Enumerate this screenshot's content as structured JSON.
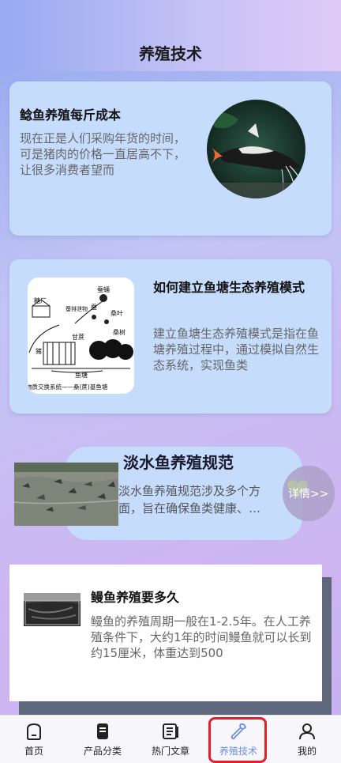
{
  "header": {
    "title": "养殖技术"
  },
  "articles": [
    {
      "title": "鲶鱼养殖每斤成本",
      "desc": "现在正是人们采购年货的时间，可是猪肉的价格一直居高不下，让很多消费者望而",
      "image": "catfish-photo"
    },
    {
      "title": "如何建立鱼塘生态养殖模式",
      "desc": "建立鱼塘生态养殖模式是指在鱼塘养殖过程中，通过模拟自然生态系统，实现鱼类",
      "image": "ecosystem-diagram",
      "diagram_labels": [
        "蚕蛹",
        "糖厂",
        "蚕排泄物",
        "蚕",
        "桑叶",
        "甘蔗",
        "桑树",
        "猪",
        "鱼塘",
        "物质交换系统——桑(蔗)基鱼塘"
      ]
    },
    {
      "title": "淡水鱼养殖规范",
      "desc_line1": "淡水鱼养殖规范涉及多个方",
      "desc_line2": "面，旨在确保鱼类健康、…",
      "detail_label": "详情>>",
      "image": "fish-pond-photo"
    },
    {
      "title": "鳗鱼养殖要多久",
      "desc": "鳗鱼的养殖周期一般在1-2.5年。在人工养殖条件下，大约1年的时间鳗鱼就可以长到约15厘米，体重达到500",
      "image": "eel-farm-photo"
    }
  ],
  "tabbar": {
    "items": [
      {
        "label": "首页",
        "icon": "home-icon"
      },
      {
        "label": "产品分类",
        "icon": "phone-icon"
      },
      {
        "label": "热门文章",
        "icon": "document-icon"
      },
      {
        "label": "养殖技术",
        "icon": "wrench-icon"
      },
      {
        "label": "我的",
        "icon": "person-icon"
      }
    ],
    "active": "养殖技术"
  },
  "colors": {
    "card": "#c5dcfc",
    "active_tab": "#6c8de8",
    "highlight": "#e0202a"
  }
}
